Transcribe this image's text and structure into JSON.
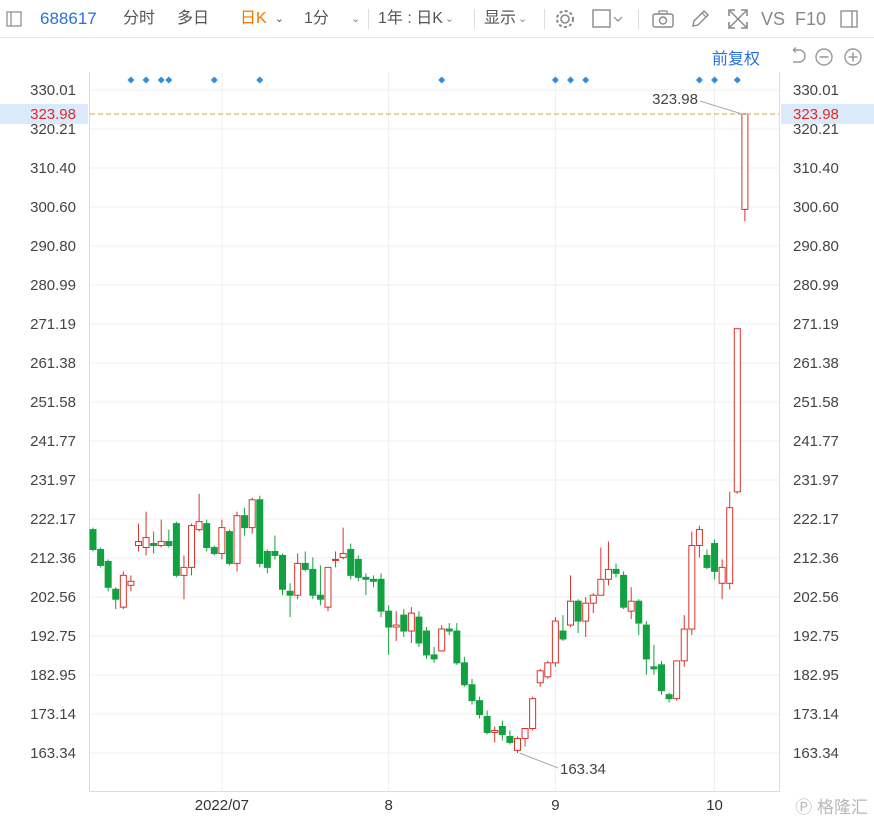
{
  "toolbar": {
    "code": "688617",
    "tab_intraday": "分时",
    "tab_multiday": "多日",
    "tab_daily": "日K",
    "period_1min": "1分",
    "range_select": "1年 : 日K",
    "display_label": "显示",
    "vs_label": "VS",
    "f10_label": "F10"
  },
  "subbar": {
    "adjust_label": "前复权"
  },
  "watermark": "格隆汇",
  "colors": {
    "up": "#d9322c",
    "down": "#12a141",
    "price_line": "#d4a24a",
    "marker": "#2f8ee0",
    "current_bg": "#dbeafb",
    "current_text": "#e02828"
  },
  "chart_data": {
    "type": "candlestick",
    "x_tick_labels": [
      "2022/07",
      "8",
      "9",
      "10"
    ],
    "y_tick_labels": [
      "330.01",
      "320.21",
      "310.40",
      "300.60",
      "290.80",
      "280.99",
      "271.19",
      "261.38",
      "251.58",
      "241.77",
      "231.97",
      "222.17",
      "212.36",
      "202.56",
      "192.75",
      "182.95",
      "173.14",
      "163.34"
    ],
    "ylim": [
      160.0,
      333.0
    ],
    "current_price": "323.98",
    "max_label": "323.98",
    "min_label": "163.34",
    "candles": [
      {
        "o": 219.5,
        "h": 220.0,
        "l": 214.0,
        "c": 214.5
      },
      {
        "o": 214.5,
        "h": 215.0,
        "l": 210.0,
        "c": 210.5
      },
      {
        "o": 211.5,
        "h": 212.0,
        "l": 204.0,
        "c": 205.0
      },
      {
        "o": 204.5,
        "h": 205.0,
        "l": 199.5,
        "c": 202.0
      },
      {
        "o": 200.0,
        "h": 209.0,
        "l": 199.5,
        "c": 208.0
      },
      {
        "o": 205.5,
        "h": 208.0,
        "l": 204.0,
        "c": 206.5
      },
      {
        "o": 215.5,
        "h": 221.0,
        "l": 214.0,
        "c": 216.5
      },
      {
        "o": 215.0,
        "h": 224.0,
        "l": 213.0,
        "c": 217.5
      },
      {
        "o": 216.0,
        "h": 219.0,
        "l": 213.5,
        "c": 215.5
      },
      {
        "o": 215.5,
        "h": 222.0,
        "l": 215.0,
        "c": 216.5
      },
      {
        "o": 216.5,
        "h": 219.5,
        "l": 215.0,
        "c": 215.5
      },
      {
        "o": 221.0,
        "h": 221.5,
        "l": 207.5,
        "c": 208.0
      },
      {
        "o": 208.0,
        "h": 213.0,
        "l": 202.0,
        "c": 210.0
      },
      {
        "o": 210.0,
        "h": 221.0,
        "l": 208.0,
        "c": 220.5
      },
      {
        "o": 219.5,
        "h": 228.5,
        "l": 219.0,
        "c": 221.5
      },
      {
        "o": 221.0,
        "h": 222.0,
        "l": 214.0,
        "c": 215.0
      },
      {
        "o": 215.0,
        "h": 215.5,
        "l": 213.0,
        "c": 213.5
      },
      {
        "o": 213.5,
        "h": 222.0,
        "l": 212.0,
        "c": 220.0
      },
      {
        "o": 219.0,
        "h": 219.5,
        "l": 210.5,
        "c": 211.0
      },
      {
        "o": 211.0,
        "h": 224.0,
        "l": 209.0,
        "c": 223.0
      },
      {
        "o": 223.0,
        "h": 225.0,
        "l": 218.0,
        "c": 220.0
      },
      {
        "o": 220.0,
        "h": 227.5,
        "l": 218.5,
        "c": 227.0
      },
      {
        "o": 227.0,
        "h": 228.0,
        "l": 210.0,
        "c": 211.0
      },
      {
        "o": 214.0,
        "h": 214.5,
        "l": 208.5,
        "c": 210.0
      },
      {
        "o": 214.0,
        "h": 218.0,
        "l": 212.0,
        "c": 213.0
      },
      {
        "o": 213.0,
        "h": 213.5,
        "l": 203.0,
        "c": 204.5
      },
      {
        "o": 204.0,
        "h": 206.0,
        "l": 197.5,
        "c": 203.0
      },
      {
        "o": 203.0,
        "h": 213.5,
        "l": 202.0,
        "c": 211.0
      },
      {
        "o": 211.0,
        "h": 214.0,
        "l": 209.0,
        "c": 209.5
      },
      {
        "o": 209.5,
        "h": 212.5,
        "l": 202.0,
        "c": 203.0
      },
      {
        "o": 203.0,
        "h": 210.5,
        "l": 200.5,
        "c": 202.0
      },
      {
        "o": 200.0,
        "h": 210.0,
        "l": 199.0,
        "c": 210.0
      },
      {
        "o": 212.0,
        "h": 214.0,
        "l": 210.0,
        "c": 212.0
      },
      {
        "o": 212.5,
        "h": 220.0,
        "l": 212.0,
        "c": 213.5
      },
      {
        "o": 214.5,
        "h": 216.0,
        "l": 207.0,
        "c": 208.0
      },
      {
        "o": 212.0,
        "h": 213.0,
        "l": 206.5,
        "c": 207.5
      },
      {
        "o": 207.5,
        "h": 208.5,
        "l": 203.0,
        "c": 207.0
      },
      {
        "o": 207.0,
        "h": 208.0,
        "l": 205.0,
        "c": 206.5
      },
      {
        "o": 207.0,
        "h": 208.5,
        "l": 197.5,
        "c": 199.0
      },
      {
        "o": 199.0,
        "h": 200.5,
        "l": 188.0,
        "c": 195.0
      },
      {
        "o": 195.0,
        "h": 199.0,
        "l": 191.5,
        "c": 195.5
      },
      {
        "o": 198.0,
        "h": 199.5,
        "l": 192.5,
        "c": 194.0
      },
      {
        "o": 194.0,
        "h": 200.0,
        "l": 191.0,
        "c": 198.5
      },
      {
        "o": 197.5,
        "h": 199.0,
        "l": 190.0,
        "c": 191.0
      },
      {
        "o": 194.0,
        "h": 195.0,
        "l": 187.0,
        "c": 188.0
      },
      {
        "o": 188.0,
        "h": 190.0,
        "l": 186.0,
        "c": 187.0
      },
      {
        "o": 189.0,
        "h": 195.5,
        "l": 189.0,
        "c": 194.5
      },
      {
        "o": 194.5,
        "h": 196.0,
        "l": 193.0,
        "c": 194.0
      },
      {
        "o": 194.0,
        "h": 196.0,
        "l": 185.5,
        "c": 186.0
      },
      {
        "o": 186.0,
        "h": 187.5,
        "l": 180.0,
        "c": 180.5
      },
      {
        "o": 180.5,
        "h": 182.0,
        "l": 175.5,
        "c": 176.5
      },
      {
        "o": 176.5,
        "h": 177.5,
        "l": 172.0,
        "c": 173.0
      },
      {
        "o": 172.5,
        "h": 174.0,
        "l": 168.0,
        "c": 168.5
      },
      {
        "o": 168.5,
        "h": 170.0,
        "l": 166.0,
        "c": 169.0
      },
      {
        "o": 170.0,
        "h": 171.5,
        "l": 166.5,
        "c": 168.0
      },
      {
        "o": 167.5,
        "h": 169.0,
        "l": 165.5,
        "c": 166.0
      },
      {
        "o": 164.0,
        "h": 167.5,
        "l": 163.34,
        "c": 167.0
      },
      {
        "o": 167.0,
        "h": 169.0,
        "l": 165.0,
        "c": 169.5
      },
      {
        "o": 169.5,
        "h": 177.5,
        "l": 169.0,
        "c": 177.0
      },
      {
        "o": 181.0,
        "h": 184.5,
        "l": 180.0,
        "c": 184.0
      },
      {
        "o": 182.5,
        "h": 186.5,
        "l": 182.0,
        "c": 186.0
      },
      {
        "o": 186.0,
        "h": 197.5,
        "l": 185.0,
        "c": 196.5
      },
      {
        "o": 194.0,
        "h": 198.0,
        "l": 191.5,
        "c": 192.0
      },
      {
        "o": 195.5,
        "h": 208.0,
        "l": 195.0,
        "c": 201.5
      },
      {
        "o": 201.5,
        "h": 202.0,
        "l": 193.5,
        "c": 196.5
      },
      {
        "o": 196.5,
        "h": 202.5,
        "l": 192.5,
        "c": 201.0
      },
      {
        "o": 201.0,
        "h": 203.5,
        "l": 198.5,
        "c": 203.0
      },
      {
        "o": 203.0,
        "h": 215.0,
        "l": 203.0,
        "c": 207.0
      },
      {
        "o": 207.0,
        "h": 216.5,
        "l": 205.5,
        "c": 209.5
      },
      {
        "o": 209.5,
        "h": 211.0,
        "l": 207.5,
        "c": 208.5
      },
      {
        "o": 208.0,
        "h": 209.0,
        "l": 199.5,
        "c": 200.0
      },
      {
        "o": 199.0,
        "h": 205.0,
        "l": 197.0,
        "c": 201.5
      },
      {
        "o": 201.5,
        "h": 202.0,
        "l": 193.0,
        "c": 196.0
      },
      {
        "o": 195.5,
        "h": 196.5,
        "l": 183.0,
        "c": 187.0
      },
      {
        "o": 185.0,
        "h": 190.5,
        "l": 183.0,
        "c": 184.5
      },
      {
        "o": 185.5,
        "h": 186.5,
        "l": 178.0,
        "c": 179.0
      },
      {
        "o": 178.0,
        "h": 178.5,
        "l": 176.0,
        "c": 177.0
      },
      {
        "o": 177.0,
        "h": 186.5,
        "l": 176.5,
        "c": 186.5
      },
      {
        "o": 186.5,
        "h": 198.0,
        "l": 185.0,
        "c": 194.5
      },
      {
        "o": 194.5,
        "h": 219.0,
        "l": 193.0,
        "c": 215.5
      },
      {
        "o": 215.5,
        "h": 220.5,
        "l": 212.5,
        "c": 219.5
      },
      {
        "o": 213.0,
        "h": 214.5,
        "l": 209.5,
        "c": 210.0
      },
      {
        "o": 216.0,
        "h": 217.0,
        "l": 207.0,
        "c": 209.0
      },
      {
        "o": 206.0,
        "h": 212.0,
        "l": 202.0,
        "c": 210.0
      },
      {
        "o": 206.0,
        "h": 229.0,
        "l": 204.5,
        "c": 225.0
      },
      {
        "o": 229.0,
        "h": 270.0,
        "l": 228.5,
        "c": 270.0
      },
      {
        "o": 300.0,
        "h": 323.98,
        "l": 297.0,
        "c": 323.98
      }
    ],
    "event_marker_indices": [
      5,
      7,
      9,
      10,
      16,
      22,
      46,
      61,
      63,
      65,
      80,
      82,
      85
    ]
  }
}
